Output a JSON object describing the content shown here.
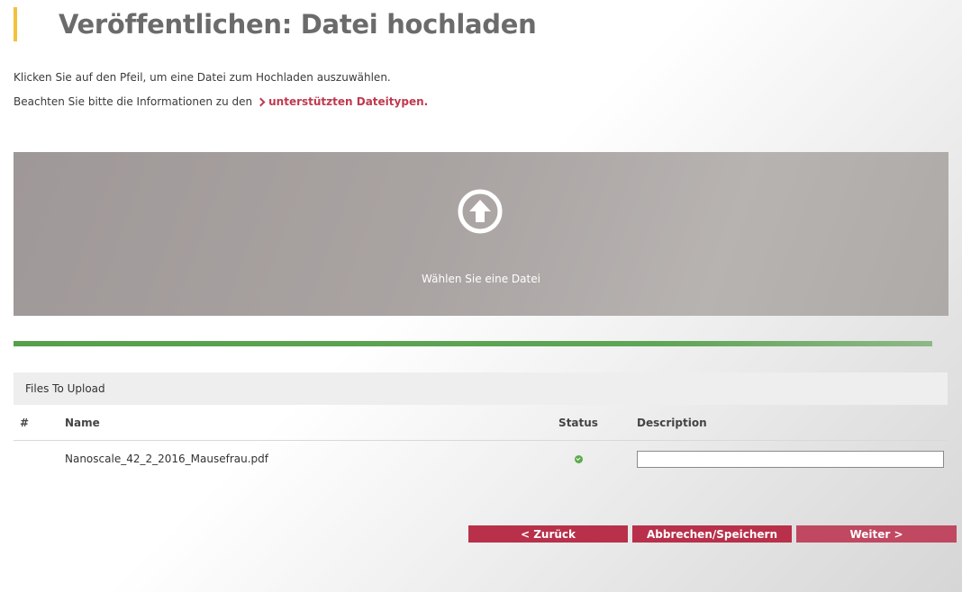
{
  "page": {
    "title": "Veröffentlichen: Datei hochladen",
    "accent_color": "#f3c13c"
  },
  "intro": {
    "line1": "Klicken Sie auf den Pfeil, um eine Datei zum Hochladen auszuwählen.",
    "line2_prefix": "Beachten Sie bitte die Informationen zu den",
    "line2_link": "unterstützten Dateitypen.",
    "link_color": "#c0394f"
  },
  "dropzone": {
    "icon": "upload-arrow-icon",
    "label": "Wählen Sie eine Datei"
  },
  "progress": {
    "fraction": 1.0,
    "color": "#5ea555"
  },
  "files": {
    "header": "Files To Upload",
    "columns": [
      "#",
      "Name",
      "Status",
      "Description"
    ],
    "rows": [
      {
        "num": "",
        "name": "Nanoscale_42_2_2016_Mausefrau.pdf",
        "status_icon": "check-circle-icon",
        "description": ""
      }
    ]
  },
  "buttons": {
    "back": "< Zurück",
    "save": "Abbrechen/Speichern",
    "next": "Weiter >",
    "color": "#b8304a"
  }
}
